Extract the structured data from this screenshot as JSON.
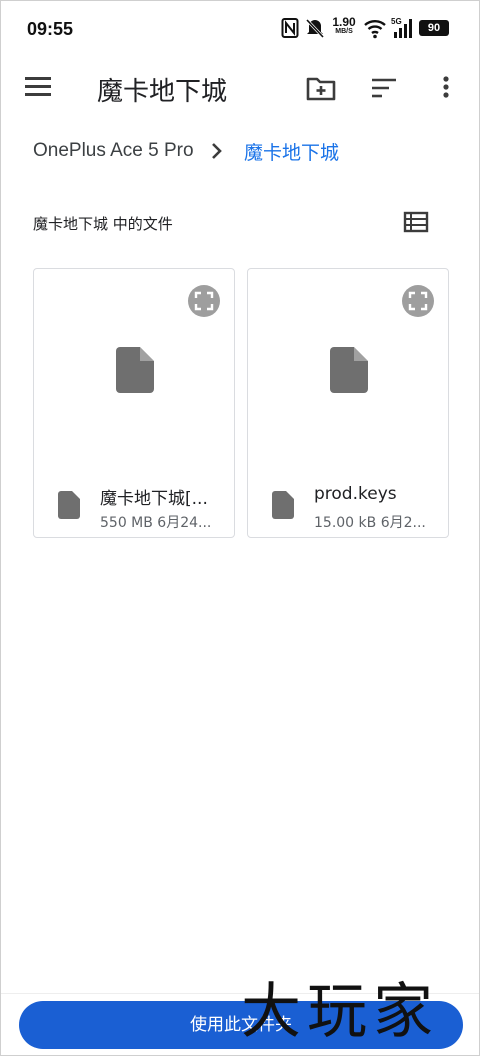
{
  "status_bar": {
    "time": "09:55",
    "net_speed_value": "1.90",
    "net_speed_unit": "MB/S",
    "network_type": "5G",
    "battery": "90"
  },
  "app_bar": {
    "title": "魔卡地下城",
    "icons": [
      "menu-icon",
      "new-folder-icon",
      "sort-icon",
      "more-vert-icon"
    ]
  },
  "breadcrumb": {
    "root": "OnePlus Ace 5 Pro",
    "current": "魔卡地下城"
  },
  "section": {
    "title": "魔卡地下城 中的文件",
    "view_icon": "list-view-icon"
  },
  "files": [
    {
      "name": "魔卡地下城[...",
      "meta": "550 MB 6月24...",
      "icon": "file-icon"
    },
    {
      "name": "prod.keys",
      "meta": "15.00 kB 6月2...",
      "icon": "file-icon"
    }
  ],
  "bottom_button": {
    "label": "使用此文件夹"
  },
  "watermark": {
    "text": "大玩家"
  },
  "colors": {
    "accent": "#1a73e8",
    "button_bg": "#1a5fd3",
    "icon_gray": "#6f6f6f"
  }
}
